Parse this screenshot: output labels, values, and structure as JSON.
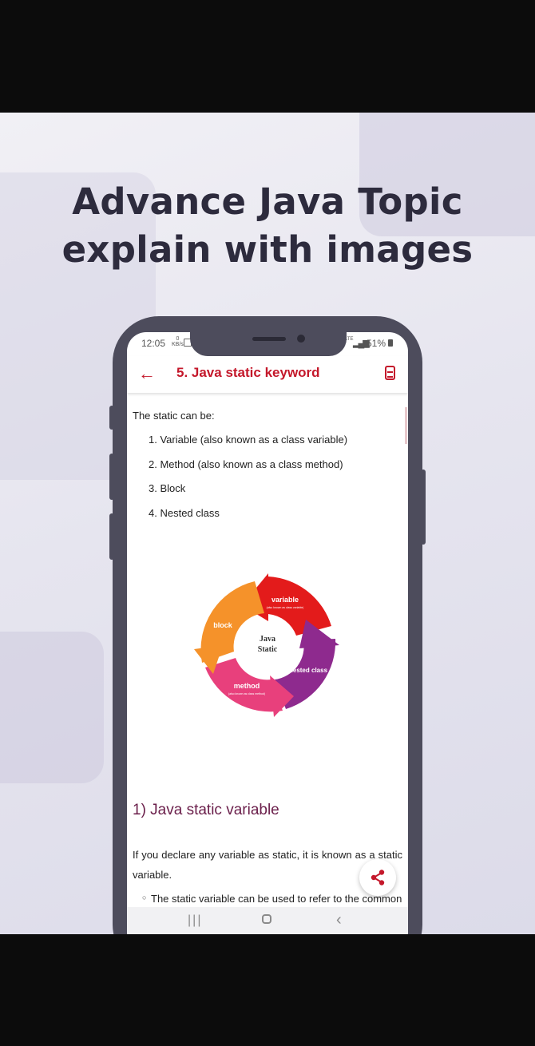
{
  "headline": {
    "line1": "Advance Java Topic",
    "line2": "explain with images"
  },
  "status_bar": {
    "time": "12:05",
    "net_speed": "0",
    "net_unit": "KB/s",
    "network": "LTE",
    "battery": "51%"
  },
  "app_bar": {
    "back_icon": "arrow-left-icon",
    "title": "5. Java static keyword",
    "action_icon": "expand-icon"
  },
  "content": {
    "intro": "The static can be:",
    "list": [
      {
        "num": "1.",
        "text": "Variable (also known as a class variable)"
      },
      {
        "num": "2.",
        "text": "Method (also known as a class method)"
      },
      {
        "num": "3.",
        "text": "Block"
      },
      {
        "num": "4.",
        "text": "Nested class"
      }
    ],
    "diagram": {
      "center": [
        "Java",
        "Static"
      ],
      "segments": [
        {
          "label": "variable",
          "sublabel": "(also known as class variable)",
          "color": "#e31b1b"
        },
        {
          "label": "nested class",
          "sublabel": "",
          "color": "#8e2a8e"
        },
        {
          "label": "method",
          "sublabel": "(also known as class method)",
          "color": "#e8407c"
        },
        {
          "label": "block",
          "sublabel": "",
          "color": "#f5922a"
        }
      ]
    },
    "heading": "1) Java static variable",
    "paragraph": "If you declare any variable as static, it is known as a static variable.",
    "bullet": "The static variable can be used to refer to the common"
  },
  "fab_icon": "share-icon",
  "nav_icons": [
    "recents-icon",
    "home-icon",
    "back-icon"
  ],
  "colors": {
    "accent": "#c4182b",
    "heading": "#6a1e4a",
    "phone_frame": "#4d4c5c"
  }
}
